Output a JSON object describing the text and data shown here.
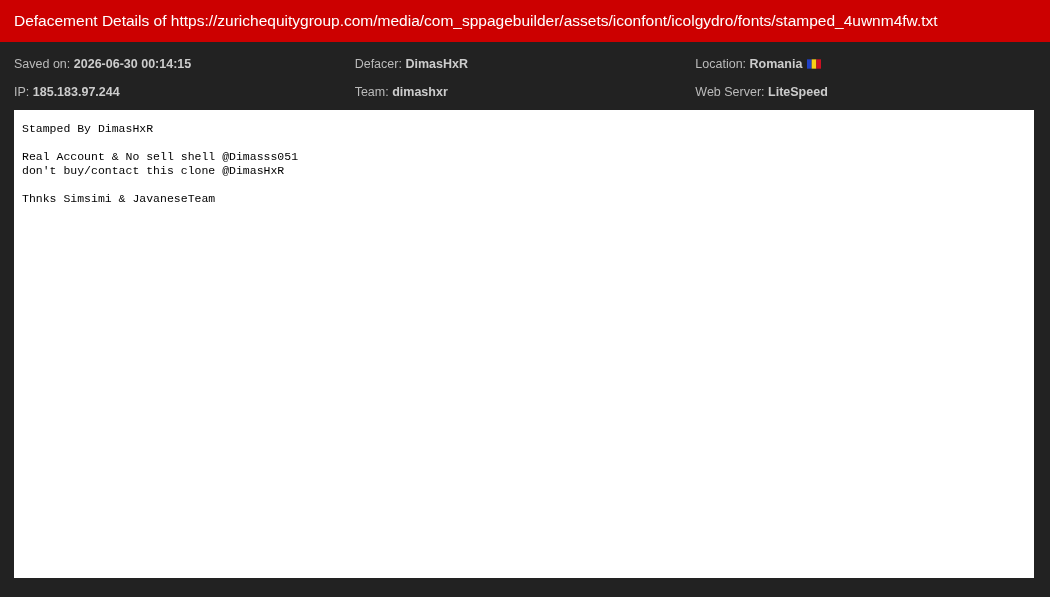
{
  "title": "Defacement Details of https://zurichequitygroup.com/media/com_sppagebuilder/assets/iconfont/icolgydro/fonts/stamped_4uwnm4fw.txt",
  "details": [
    {
      "label": "Saved on:",
      "value": "2026-06-30 00:14:15"
    },
    {
      "label": "Defacer:",
      "value": "DimasHxR"
    },
    {
      "label": "Location:",
      "value": "Romania",
      "kind": "flag"
    },
    {
      "label": "IP:",
      "value": "185.183.97.244"
    },
    {
      "label": "Team:",
      "value": "dimashxr"
    },
    {
      "label": "Web Server:",
      "value": "LiteSpeed"
    }
  ],
  "content": [
    [
      "Stamped By DimasHxR"
    ],
    [
      "Real Account & No sell shell @Dimasss051",
      "don't buy/contact this clone @DimasHxR"
    ],
    [
      "Thnks Simsimi & JavaneseTeam"
    ]
  ]
}
